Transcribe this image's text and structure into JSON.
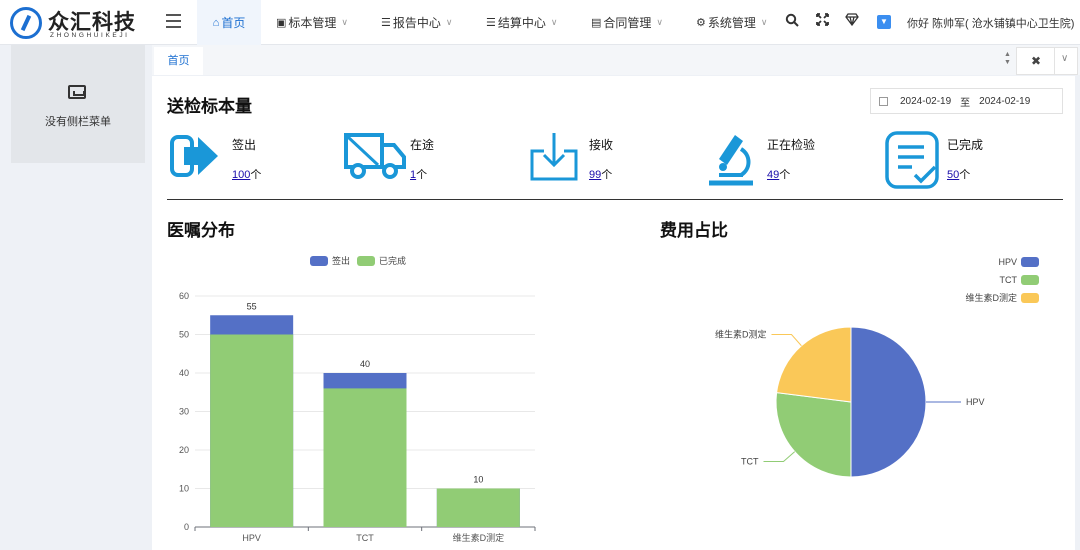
{
  "header": {
    "logo_title": "众汇科技",
    "logo_subtitle": "ZHONGHUIKEJI",
    "nav": [
      {
        "label": "首页",
        "icon": "home-icon"
      },
      {
        "label": "标本管理",
        "icon": "briefcase-icon"
      },
      {
        "label": "报告中心",
        "icon": "grid-list-icon"
      },
      {
        "label": "结算中心",
        "icon": "list-icon"
      },
      {
        "label": "合同管理",
        "icon": "document-icon"
      },
      {
        "label": "系统管理",
        "icon": "gear-icon"
      }
    ],
    "user_greeting": "你好 陈帅军( 沧水铺镇中心卫生院)"
  },
  "sidebar": {
    "empty_text": "没有侧栏菜单"
  },
  "tabs": {
    "home": "首页"
  },
  "specimen": {
    "title": "送检标本量",
    "date_from": "2024-02-19",
    "date_sep": "至",
    "date_to": "2024-02-19",
    "unit": "个",
    "stats": [
      {
        "label": "签出",
        "value": "100",
        "icon": "arrow-right-icon"
      },
      {
        "label": "在途",
        "value": "1",
        "icon": "truck-icon"
      },
      {
        "label": "接收",
        "value": "99",
        "icon": "download-icon"
      },
      {
        "label": "正在检验",
        "value": "49",
        "icon": "microscope-icon"
      },
      {
        "label": "已完成",
        "value": "50",
        "icon": "checklist-icon"
      }
    ]
  },
  "orders_title": "医嘱分布",
  "cost_title": "费用占比",
  "colors": {
    "primary": "#1c6fd1",
    "icon_blue": "#1a97d8",
    "series_blue": "#5470c6",
    "series_green": "#91cc75",
    "series_yellow": "#fac858"
  },
  "chart_data": [
    {
      "type": "bar",
      "title": "医嘱分布",
      "stacked": true,
      "categories": [
        "HPV",
        "TCT",
        "维生素D测定"
      ],
      "series": [
        {
          "name": "签出",
          "values": [
            55,
            40,
            10
          ],
          "color": "#5470c6"
        },
        {
          "name": "已完成",
          "values": [
            50,
            36,
            10
          ],
          "color": "#91cc75"
        }
      ],
      "data_labels": [
        55,
        40,
        10
      ],
      "ylim": [
        0,
        60
      ],
      "yticks": [
        0,
        10,
        20,
        30,
        40,
        50,
        60
      ],
      "legend": "top",
      "grid": true
    },
    {
      "type": "pie",
      "title": "费用占比",
      "labels": [
        "HPV",
        "TCT",
        "维生素D测定"
      ],
      "values": [
        50,
        27,
        23
      ],
      "colors": [
        "#5470c6",
        "#91cc75",
        "#fac858"
      ],
      "legend": "top-right"
    }
  ]
}
